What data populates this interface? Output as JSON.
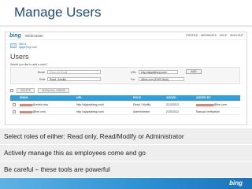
{
  "slide": {
    "title": "Manage Users"
  },
  "screenshot": {
    "brand": "bing",
    "product": "Webmaster",
    "topnav": [
      "PROFILE",
      "MESSAGES",
      "HELP",
      "SIGN OUT"
    ],
    "site_lines": [
      "Site a",
      "ajapeTing.com"
    ],
    "heading": "Users",
    "add_prompt": "Would you like to add a user?",
    "form": {
      "email_label": "Email",
      "email_placeholder": "Enter an Email",
      "url_label": "URL",
      "url_value": "http://ajapejthing.com/",
      "add_button": "ADD",
      "role_label": "Role",
      "role_value": "Read / Modify",
      "for_label": "For",
      "for_value": "@live.com [F/WFJlckK]"
    },
    "actions": {
      "delete": "DELETE",
      "show_all": "SHOW ALL USERS"
    },
    "table": {
      "headers": [
        "EMAIL",
        "URL",
        "ROLE",
        "ADDED",
        "ADDED BY"
      ],
      "rows": [
        {
          "email": "@umich.edu",
          "url": "http://ajapejthing.com/",
          "role": "Read / Modify",
          "added": "2/13/2012",
          "added_by": "@live.com"
        },
        {
          "email": "@live.com",
          "url": "http://ajapejthing.com/",
          "role": "Administrator",
          "added": "2/20/2012",
          "added_by": "Manual verification"
        }
      ]
    }
  },
  "bullets": [
    "Select roles of either: Read only, Read/Modify or Administrator",
    "Actively manage this as employees come and go",
    "Be careful – these tools are powerful"
  ],
  "footer": {
    "brand": "bing"
  },
  "colors": {
    "title": "#1f497d",
    "table_header": "#33a0de",
    "bullet_bg": "#eeeeee",
    "footer_accent": "#2a8fd0"
  }
}
